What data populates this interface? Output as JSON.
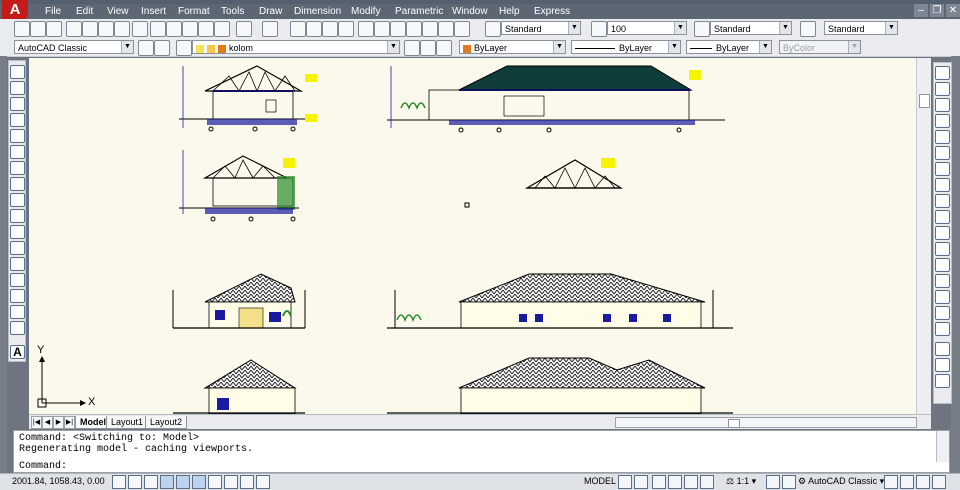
{
  "menu": {
    "items": [
      "File",
      "Edit",
      "View",
      "Insert",
      "Format",
      "Tools",
      "Draw",
      "Dimension",
      "Modify",
      "Parametric",
      "Window",
      "Help",
      "Express"
    ]
  },
  "toolbar1": {
    "text_style": "Standard",
    "dim_scale": "100",
    "dim_style": "Standard",
    "table_style": "Standard"
  },
  "toolbar2": {
    "workspace": "AutoCAD Classic",
    "layer": "kolom",
    "color": "ByLayer",
    "linetype": "ByLayer",
    "lineweight": "ByLayer",
    "plotstyle": "ByColor"
  },
  "ucs": {
    "y_label": "Y",
    "x_label": "X"
  },
  "tabs": [
    "Model",
    "Layout1",
    "Layout2"
  ],
  "command": {
    "history": [
      "Command:  <Switching to: Model>",
      "Regenerating model - caching viewports."
    ],
    "prompt": "Command:"
  },
  "status": {
    "coords": "2001.84, 1058.43, 0.00",
    "model_label": "MODEL",
    "annotation_scale": "1:1",
    "workspace": "AutoCAD Classic"
  },
  "colors": {
    "canvas": "#fbf9ec",
    "accent_red": "#c41a1a",
    "layer_color": "#e07a1d",
    "drawing_blue": "#1a1aa0"
  }
}
